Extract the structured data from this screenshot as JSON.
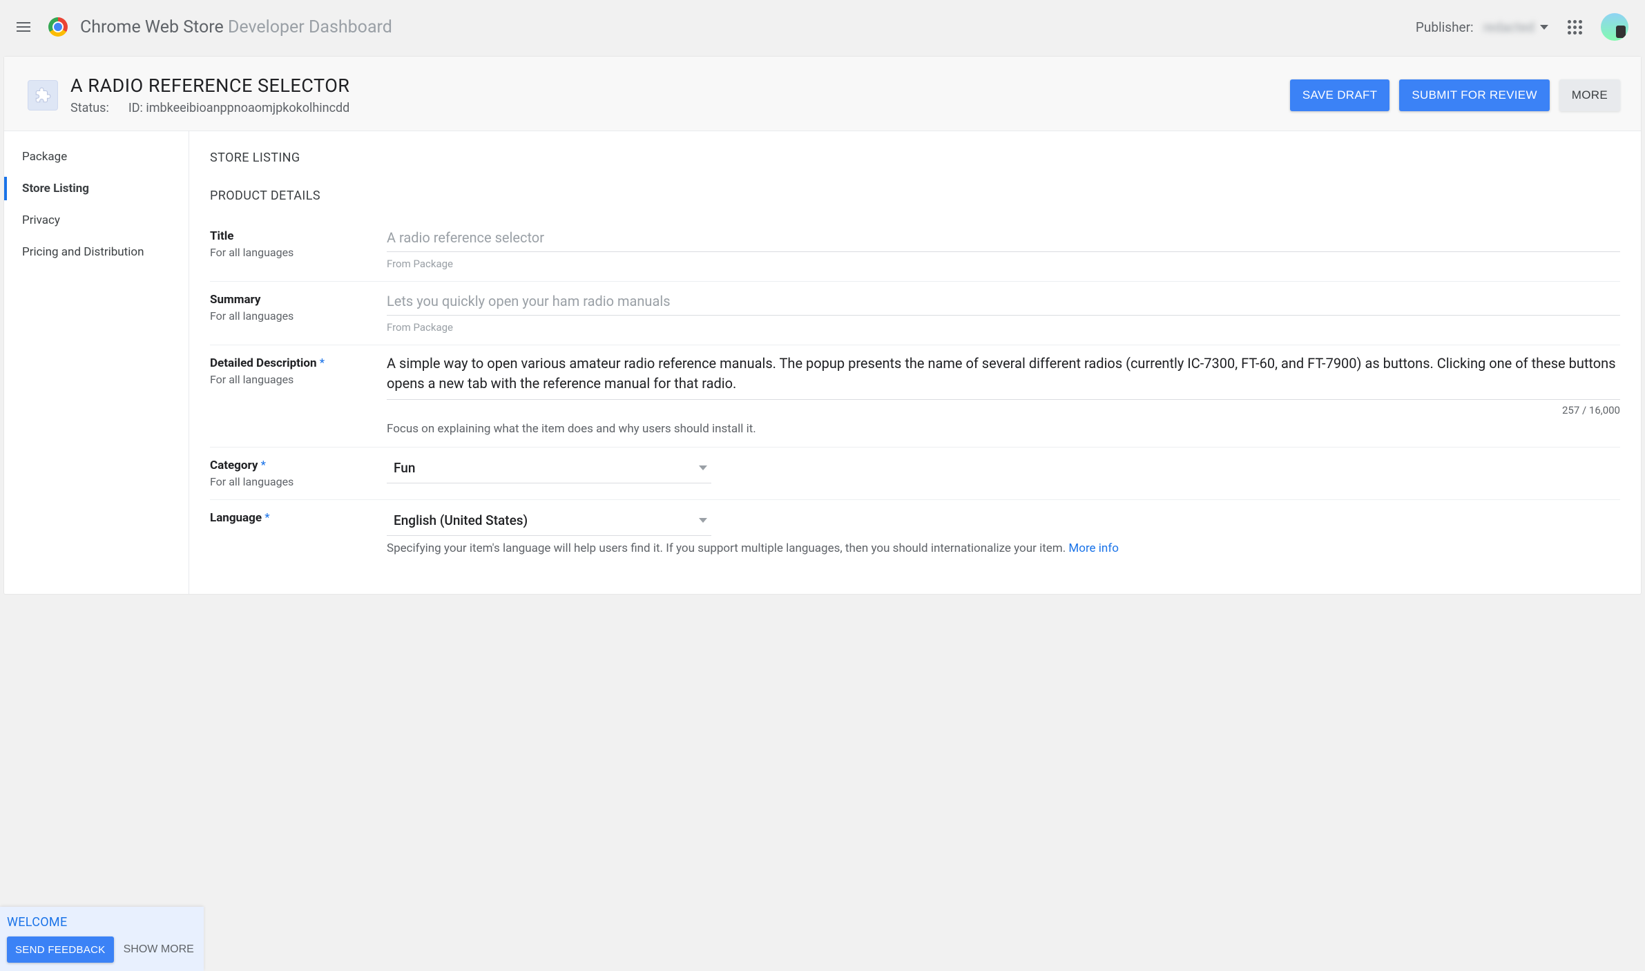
{
  "appbar": {
    "title_strong": "Chrome Web Store",
    "title_light": "Developer Dashboard",
    "publisher_label": "Publisher:",
    "publisher_value": "redacted"
  },
  "item": {
    "name": "A RADIO REFERENCE SELECTOR",
    "status_label": "Status:",
    "status_value": "",
    "id_label": "ID:",
    "id_value": "imbkeeibioanppnoaomjpkokolhincdd",
    "actions": {
      "save_draft": "SAVE DRAFT",
      "submit_review": "SUBMIT FOR REVIEW",
      "more": "MORE"
    }
  },
  "sidenav": {
    "items": [
      {
        "label": "Package",
        "active": false
      },
      {
        "label": "Store Listing",
        "active": true
      },
      {
        "label": "Privacy",
        "active": false
      },
      {
        "label": "Pricing and Distribution",
        "active": false
      }
    ]
  },
  "content": {
    "section_title": "STORE LISTING",
    "subsection_title": "PRODUCT DETAILS",
    "for_all_languages": "For all languages",
    "from_package": "From Package",
    "fields": {
      "title": {
        "label": "Title",
        "value": "A radio reference selector"
      },
      "summary": {
        "label": "Summary",
        "value": "Lets you quickly open your ham radio manuals"
      },
      "description": {
        "label": "Detailed Description",
        "value": "A simple way to open various amateur radio reference manuals. The popup presents the name of several different radios (currently IC-7300, FT-60, and FT-7900) as buttons. Clicking one of these buttons opens a new tab with the reference manual for that radio.",
        "counter": "257 / 16,000",
        "helper": "Focus on explaining what the item does and why users should install it."
      },
      "category": {
        "label": "Category",
        "selected": "Fun"
      },
      "language": {
        "label": "Language",
        "selected": "English (United States)",
        "helper": "Specifying your item's language will help users find it. If you support multiple languages, then you should internationalize your item. ",
        "more_info": "More info"
      }
    }
  },
  "feedback": {
    "welcome": "WELCOME",
    "send": "SEND FEEDBACK",
    "show_more": "SHOW MORE"
  }
}
